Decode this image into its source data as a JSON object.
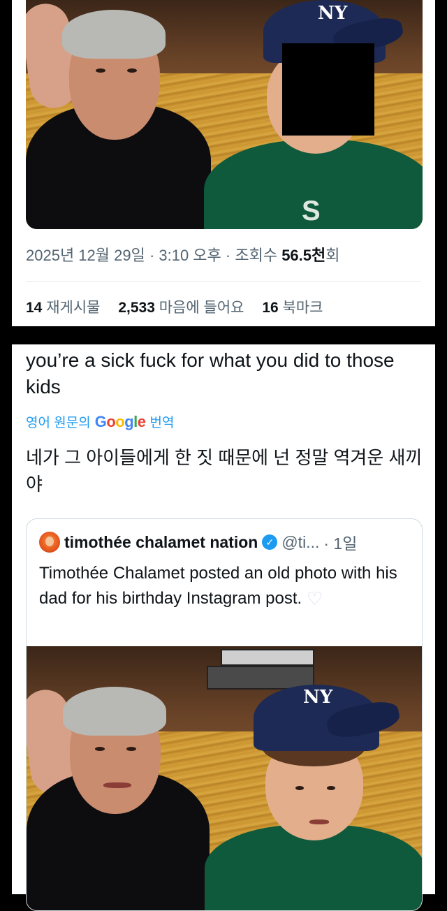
{
  "post": {
    "date_time": "2025년 12월 29일 · 3:10 오후 · 조회수 ",
    "views": "56.5천",
    "views_suffix": "회",
    "reposts_count": "14",
    "reposts_label": "재게시물",
    "likes_count": "2,533",
    "likes_label": "마음에 들어요",
    "bookmarks_count": "16",
    "bookmarks_label": "북마크"
  },
  "reply": {
    "text": "you’re a sick fuck for what you did to those kids",
    "translate_prefix": "영어 원문의",
    "translate_brand": "Google",
    "translate_suffix": "번역",
    "translated_text": "네가 그 아이들에게 한 짓 때문에 넌 정말 역겨운 새끼야"
  },
  "quote": {
    "name": "timothée chalamet nation",
    "handle": "@ti...",
    "time": "· 1일",
    "text": "Timothée Chalamet posted an old photo with his dad for his birthday Instagram post.",
    "verified_icon": "verified-badge-icon",
    "emoji": "white-heart-icon"
  },
  "photo_labels": {
    "cap_logo": "NY",
    "shirt_mark": "S"
  },
  "colors": {
    "link": "#1d9bf0",
    "secondary_text": "#536471",
    "cap": "#1d2a55",
    "shirt": "#0f5a3c"
  }
}
